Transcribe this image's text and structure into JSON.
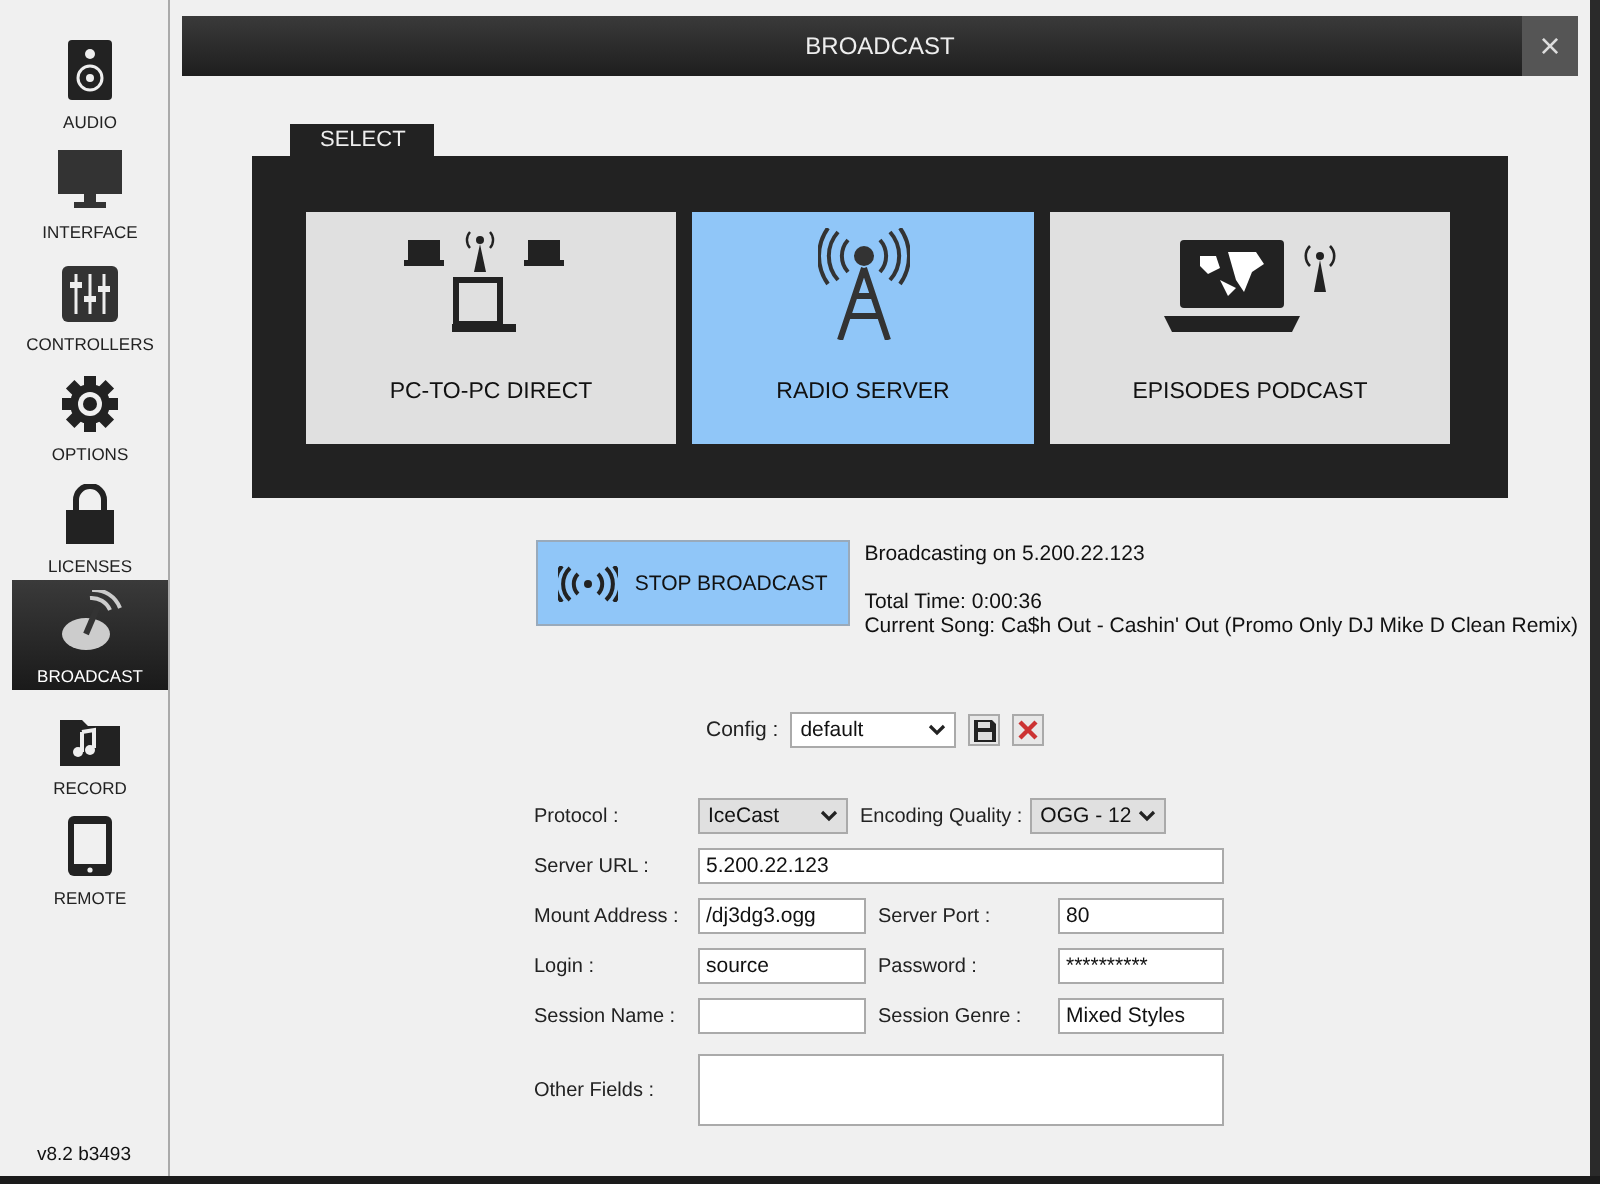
{
  "sidebar": {
    "items": [
      {
        "label": "AUDIO",
        "selected": false
      },
      {
        "label": "INTERFACE",
        "selected": false
      },
      {
        "label": "CONTROLLERS",
        "selected": false
      },
      {
        "label": "OPTIONS",
        "selected": false
      },
      {
        "label": "LICENSES",
        "selected": false
      },
      {
        "label": "BROADCAST",
        "selected": true
      },
      {
        "label": "RECORD",
        "selected": false
      },
      {
        "label": "REMOTE",
        "selected": false
      }
    ],
    "version": "v8.2 b3493"
  },
  "window": {
    "title": "BROADCAST",
    "close": "×"
  },
  "select": {
    "tab": "SELECT",
    "modes": [
      {
        "label": "PC-TO-PC DIRECT",
        "selected": false
      },
      {
        "label": "RADIO SERVER",
        "selected": true
      },
      {
        "label": "EPISODES PODCAST",
        "selected": false
      }
    ]
  },
  "stop_button": "STOP BROADCAST",
  "status": {
    "line_1": "Broadcasting on 5.200.22.123",
    "line_2": "Total Time: 0:00:36",
    "line_3": "Current Song: Ca$h Out - Cashin' Out (Promo Only DJ Mike D Clean Remix)"
  },
  "config": {
    "label": "Config :",
    "value": "default"
  },
  "form": {
    "protocol": {
      "label": "Protocol :",
      "value": "IceCast"
    },
    "quality": {
      "label": "Encoding Quality :",
      "value": "OGG - 12"
    },
    "server_url": {
      "label": "Server URL :",
      "value": "5.200.22.123"
    },
    "mount": {
      "label": "Mount Address :",
      "value": "/dj3dg3.ogg"
    },
    "port": {
      "label": "Server Port :",
      "value": "80"
    },
    "login": {
      "label": "Login :",
      "value": "source"
    },
    "password": {
      "label": "Password :",
      "value": "**********"
    },
    "session_name": {
      "label": "Session Name :"
    },
    "session_genre": {
      "label": "Session Genre :",
      "value": "Mixed Styles"
    },
    "other": {
      "label": "Other Fields :"
    }
  }
}
